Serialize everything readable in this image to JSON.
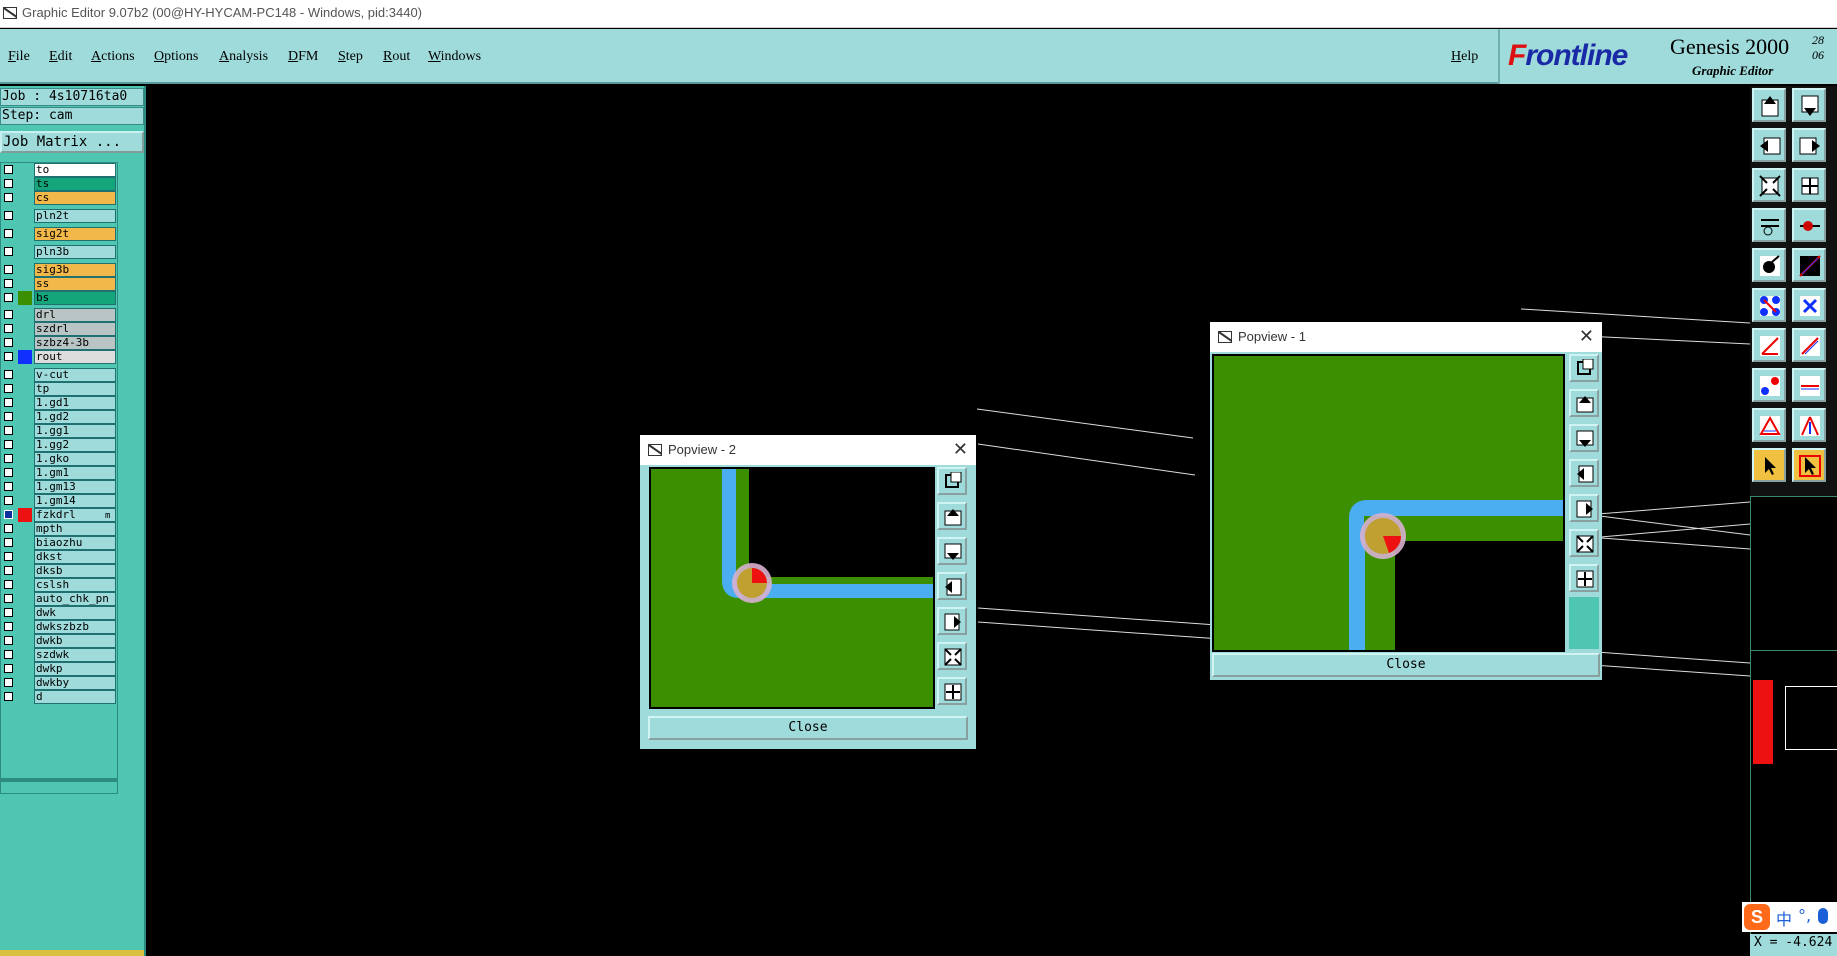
{
  "window": {
    "title": "Graphic Editor 9.07b2 (00@HY-HYCAM-PC148 - Windows, pid:3440)"
  },
  "menu": {
    "items": [
      "File",
      "Edit",
      "Actions",
      "Options",
      "Analysis",
      "DFM",
      "Step",
      "Rout",
      "Windows"
    ],
    "help": "Help"
  },
  "brand": {
    "logo_prefix": "F",
    "logo_rest": "rontline",
    "product": "Genesis 2000",
    "subtitle": "Graphic Editor",
    "date_line1": "28",
    "date_line2": "06"
  },
  "job": {
    "job_label": "Job : 4s10716ta0",
    "step_label": "Step: cam",
    "matrix_button": "Job Matrix ..."
  },
  "layers": [
    {
      "name": "to",
      "color": "#ffffff",
      "swatch": ""
    },
    {
      "name": "ts",
      "color": "#15a57a",
      "swatch": ""
    },
    {
      "name": "cs",
      "color": "#f2b84a",
      "swatch": ""
    },
    {
      "name": "pln2t",
      "color": "#9fdbdb",
      "swatch": ""
    },
    {
      "name": "sig2t",
      "color": "#f2b84a",
      "swatch": ""
    },
    {
      "name": "pln3b",
      "color": "#9fdbdb",
      "swatch": ""
    },
    {
      "name": "sig3b",
      "color": "#f2b84a",
      "swatch": ""
    },
    {
      "name": "ss",
      "color": "#f2b84a",
      "swatch": ""
    },
    {
      "name": "bs",
      "color": "#15a57a",
      "swatch": "#3b8f00"
    },
    {
      "name": "drl",
      "color": "#b9c4c4",
      "swatch": ""
    },
    {
      "name": "szdrl",
      "color": "#b9c4c4",
      "swatch": ""
    },
    {
      "name": "szbz4-3b",
      "color": "#b9c4c4",
      "swatch": ""
    },
    {
      "name": "rout",
      "color": "#dddddd",
      "swatch": "#1030ff"
    },
    {
      "name": "v-cut",
      "color": "#9fdbdb",
      "swatch": ""
    },
    {
      "name": "tp",
      "color": "#9fdbdb",
      "swatch": ""
    },
    {
      "name": "1.gd1",
      "color": "#9fdbdb",
      "swatch": ""
    },
    {
      "name": "1.gd2",
      "color": "#9fdbdb",
      "swatch": ""
    },
    {
      "name": "1.gg1",
      "color": "#9fdbdb",
      "swatch": ""
    },
    {
      "name": "1.gg2",
      "color": "#9fdbdb",
      "swatch": ""
    },
    {
      "name": "1.gko",
      "color": "#9fdbdb",
      "swatch": ""
    },
    {
      "name": "1.gm1",
      "color": "#9fdbdb",
      "swatch": ""
    },
    {
      "name": "1.gm13",
      "color": "#9fdbdb",
      "swatch": ""
    },
    {
      "name": "1.gm14",
      "color": "#9fdbdb",
      "swatch": ""
    },
    {
      "name": "fzkdrl",
      "color": "#9fdbdb",
      "swatch": "#ee1111",
      "marker": "m",
      "checked": true
    },
    {
      "name": "mpth",
      "color": "#9fdbdb",
      "swatch": ""
    },
    {
      "name": "biaozhu",
      "color": "#9fdbdb",
      "swatch": ""
    },
    {
      "name": "dkst",
      "color": "#9fdbdb",
      "swatch": ""
    },
    {
      "name": "dksb",
      "color": "#9fdbdb",
      "swatch": ""
    },
    {
      "name": "cslsh",
      "color": "#9fdbdb",
      "swatch": ""
    },
    {
      "name": "auto_chk_pn",
      "color": "#9fdbdb",
      "swatch": ""
    },
    {
      "name": "dwk",
      "color": "#9fdbdb",
      "swatch": ""
    },
    {
      "name": "dwkszbzb",
      "color": "#9fdbdb",
      "swatch": ""
    },
    {
      "name": "dwkb",
      "color": "#9fdbdb",
      "swatch": ""
    },
    {
      "name": "szdwk",
      "color": "#9fdbdb",
      "swatch": ""
    },
    {
      "name": "dwkp",
      "color": "#9fdbdb",
      "swatch": ""
    },
    {
      "name": "dwkby",
      "color": "#9fdbdb",
      "swatch": ""
    },
    {
      "name": "d",
      "color": "#9fdbdb",
      "swatch": ""
    }
  ],
  "popview2": {
    "title": "Popview - 2",
    "close_label": "Close",
    "close_x": "✕"
  },
  "popview1": {
    "title": "Popview - 1",
    "close_label": "Close",
    "close_x": "✕"
  },
  "colors": {
    "copper": "#3b8f00",
    "trace": "#4aaef0",
    "pad": "#c8a0c8",
    "drill": "#ee1111",
    "cyan": "#9fdbdb"
  },
  "ime": {
    "logo": "S",
    "lang": "中",
    "punct": "°,"
  },
  "status": {
    "coords": "X = -4.624"
  }
}
